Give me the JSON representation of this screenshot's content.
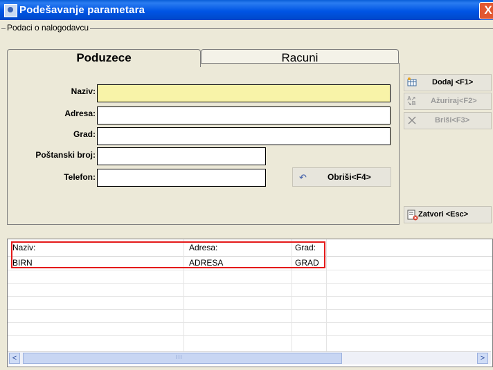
{
  "window": {
    "title": "Podešavanje parametara",
    "close_label": "X"
  },
  "group": {
    "label": "Podaci o nalogodavcu"
  },
  "tabs": [
    {
      "label": "Poduzece"
    },
    {
      "label": "Racuni"
    }
  ],
  "form": {
    "naziv_label": "Naziv:",
    "adresa_label": "Adresa:",
    "grad_label": "Grad:",
    "postanski_label": "Poštanski broj:",
    "telefon_label": "Telefon:",
    "naziv_value": "",
    "adresa_value": "",
    "grad_value": "",
    "postanski_value": "",
    "telefon_value": "",
    "clear_label": "Obriši<F4>"
  },
  "side_buttons": {
    "add": "Dodaj <F1>",
    "update": "Ažuriraj<F2>",
    "delete": "Briši<F3>",
    "close": "Zatvori <Esc>"
  },
  "grid": {
    "columns": [
      "Naziv:",
      "Adresa:",
      "Grad:"
    ],
    "rows": [
      [
        "BIRN",
        "ADRESA",
        "GRAD"
      ]
    ]
  },
  "colors": {
    "title_bar": "#0055e5",
    "highlight_field": "#f8f3a8",
    "selection_border": "#e41919"
  }
}
